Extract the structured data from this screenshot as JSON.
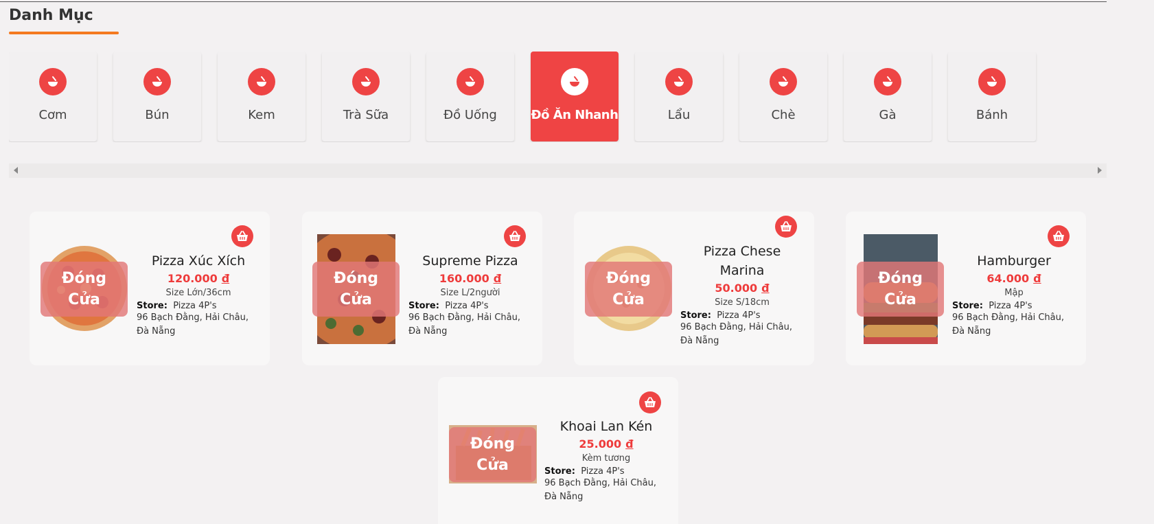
{
  "section": {
    "title": "Danh Mục"
  },
  "categories": [
    {
      "label": "Cơm",
      "active": false
    },
    {
      "label": "Bún",
      "active": false
    },
    {
      "label": "Kem",
      "active": false
    },
    {
      "label": "Trà Sữa",
      "active": false
    },
    {
      "label": "Đồ Uống",
      "active": false
    },
    {
      "label": "Đồ Ăn Nhanh",
      "active": true
    },
    {
      "label": "Lẩu",
      "active": false
    },
    {
      "label": "Chè",
      "active": false
    },
    {
      "label": "Gà",
      "active": false
    },
    {
      "label": "Bánh",
      "active": false
    }
  ],
  "common": {
    "closed_line1": "Đóng",
    "closed_line2": "Cửa",
    "store_label": "Store:",
    "currency": "đ"
  },
  "colors": {
    "accent": "#ee4444",
    "underline": "#f47a20",
    "price": "#ee3b3b"
  },
  "products": [
    {
      "name": "Pizza Xúc Xích",
      "price": "120.000",
      "size": "Size Lớn/36cm",
      "store": "Pizza 4P's",
      "address": "96 Bạch Đằng, Hải Châu, Đà Nẵng",
      "image": "pizza-image"
    },
    {
      "name": "Supreme Pizza",
      "price": "160.000",
      "size": "Size L/2người",
      "store": "Pizza 4P's",
      "address": "96 Bạch Đằng, Hải Châu, Đà Nẵng",
      "image": "pizza-image"
    },
    {
      "name": "Pizza Chese Marina",
      "price": "50.000",
      "size": "Size S/18cm",
      "store": "Pizza 4P's",
      "address": "96 Bạch Đằng, Hải Châu, Đà Nẵng",
      "image": "pizza-image"
    },
    {
      "name": "Hamburger",
      "price": "64.000",
      "size": "Mập",
      "store": "Pizza 4P's",
      "address": "96 Bạch Đằng, Hải Châu, Đà Nẵng",
      "image": "burger-image"
    },
    {
      "name": "Khoai Lan Kén",
      "price": "25.000",
      "size": "Kèm tương",
      "store": "Pizza 4P's",
      "address": "96 Bạch Đằng, Hải Châu, Đà Nẵng",
      "image": "fries-image"
    }
  ]
}
